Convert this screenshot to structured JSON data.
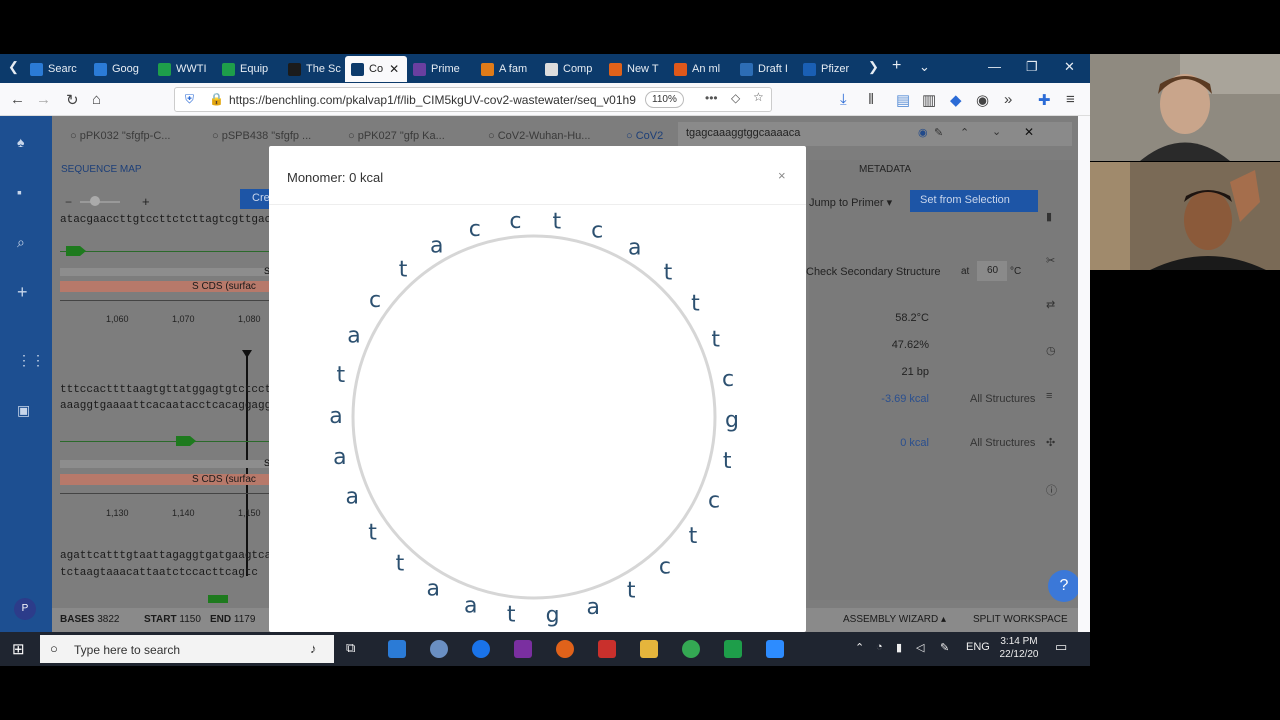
{
  "tabs": [
    {
      "label": "Searc",
      "color": "#2b7bd6"
    },
    {
      "label": "Goog",
      "color": "#2b7bd6"
    },
    {
      "label": "WWTI",
      "color": "#1e9e4a"
    },
    {
      "label": "Equip",
      "color": "#1e9e4a"
    },
    {
      "label": "The Sc",
      "color": "#1b1b1b"
    },
    {
      "label": "Co",
      "color": "#0c3a6b",
      "active": true
    },
    {
      "label": "Prime",
      "color": "#6a3fa0"
    },
    {
      "label": "A fam",
      "color": "#e07b18"
    },
    {
      "label": "Comp",
      "color": "#dddddd"
    },
    {
      "label": "New T",
      "color": "#e0621a"
    },
    {
      "label": "An ml",
      "color": "#e0581a"
    },
    {
      "label": "Draft I",
      "color": "#2d6db5"
    },
    {
      "label": "Pfizer",
      "color": "#1a5fb4"
    }
  ],
  "url": "https://benchling.com/pkalvap1/f/lib_CIM5kgUV-cov2-wastewater/seq_v01h9",
  "zoom": "110%",
  "seq_tabs": [
    "pPK032 \"sfgfp-C...",
    "pSPB438 \"sfgfp ...",
    "pPK027 \"gfp Ka...",
    "CoV2-Wuhan-Hu...",
    "CoV2"
  ],
  "search_query": "tgagcaaaggtggcaaaaca",
  "sequence_map_label": "SEQUENCE MAP",
  "create_label": "Cre",
  "metadata_label": "METADATA",
  "jump_to_primer": "Jump to Primer",
  "set_from_selection": "Set from Selection",
  "check_secondary": "Check Secondary Structure",
  "at_label": "at",
  "temp_value": "60",
  "temp_unit": "°C",
  "props": [
    {
      "value": "58.2°C",
      "extra": ""
    },
    {
      "value": "47.62%",
      "extra": ""
    },
    {
      "value": "21 bp",
      "extra": ""
    },
    {
      "value": "-3.69 kcal",
      "extra": "All Structures"
    },
    {
      "value": "0 kcal",
      "extra": "All Structures"
    }
  ],
  "seq_rows": [
    {
      "text": "atacgaaccttgtccttctcttagtcgttgac"
    },
    {
      "text": "tttccacttttaagtgttatggagtgtctcctat"
    },
    {
      "text": "aaaggtgaaaattcacaatacctcacaggagg"
    },
    {
      "text": "agattcatttgtaattagaggtgatgaagtcag"
    },
    {
      "text": "tctaagtaaacattaatctccacttcagtc"
    }
  ],
  "cds_label": "S CDS  (surfac",
  "s_label": "S",
  "ticks1": [
    "1,060",
    "1,070",
    "1,080"
  ],
  "ticks2": [
    "1,130",
    "1,140",
    "1,150"
  ],
  "bottom": {
    "bases_label": "BASES",
    "bases": "3822",
    "start_label": "START",
    "start": "1150",
    "end_label": "END",
    "end": "1179",
    "assembly": "ASSEMBLY WIZARD",
    "split": "SPLIT WORKSPACE"
  },
  "modal": {
    "title": "Monomer: 0 kcal",
    "close": "×",
    "bases": [
      "t",
      "c",
      "a",
      "t",
      "t",
      "t",
      "c",
      "g",
      "t",
      "c",
      "t",
      "c",
      "t",
      "a",
      "g",
      "t",
      "a",
      "a",
      "t",
      "t",
      "a",
      "a",
      "a",
      "t",
      "a",
      "c",
      "t",
      "a",
      "c",
      "c"
    ]
  },
  "help": "?",
  "avatar": "P",
  "taskbar": {
    "search_placeholder": "Type here to search",
    "lang": "ENG",
    "time": "3:14 PM",
    "date": "22/12/20"
  }
}
